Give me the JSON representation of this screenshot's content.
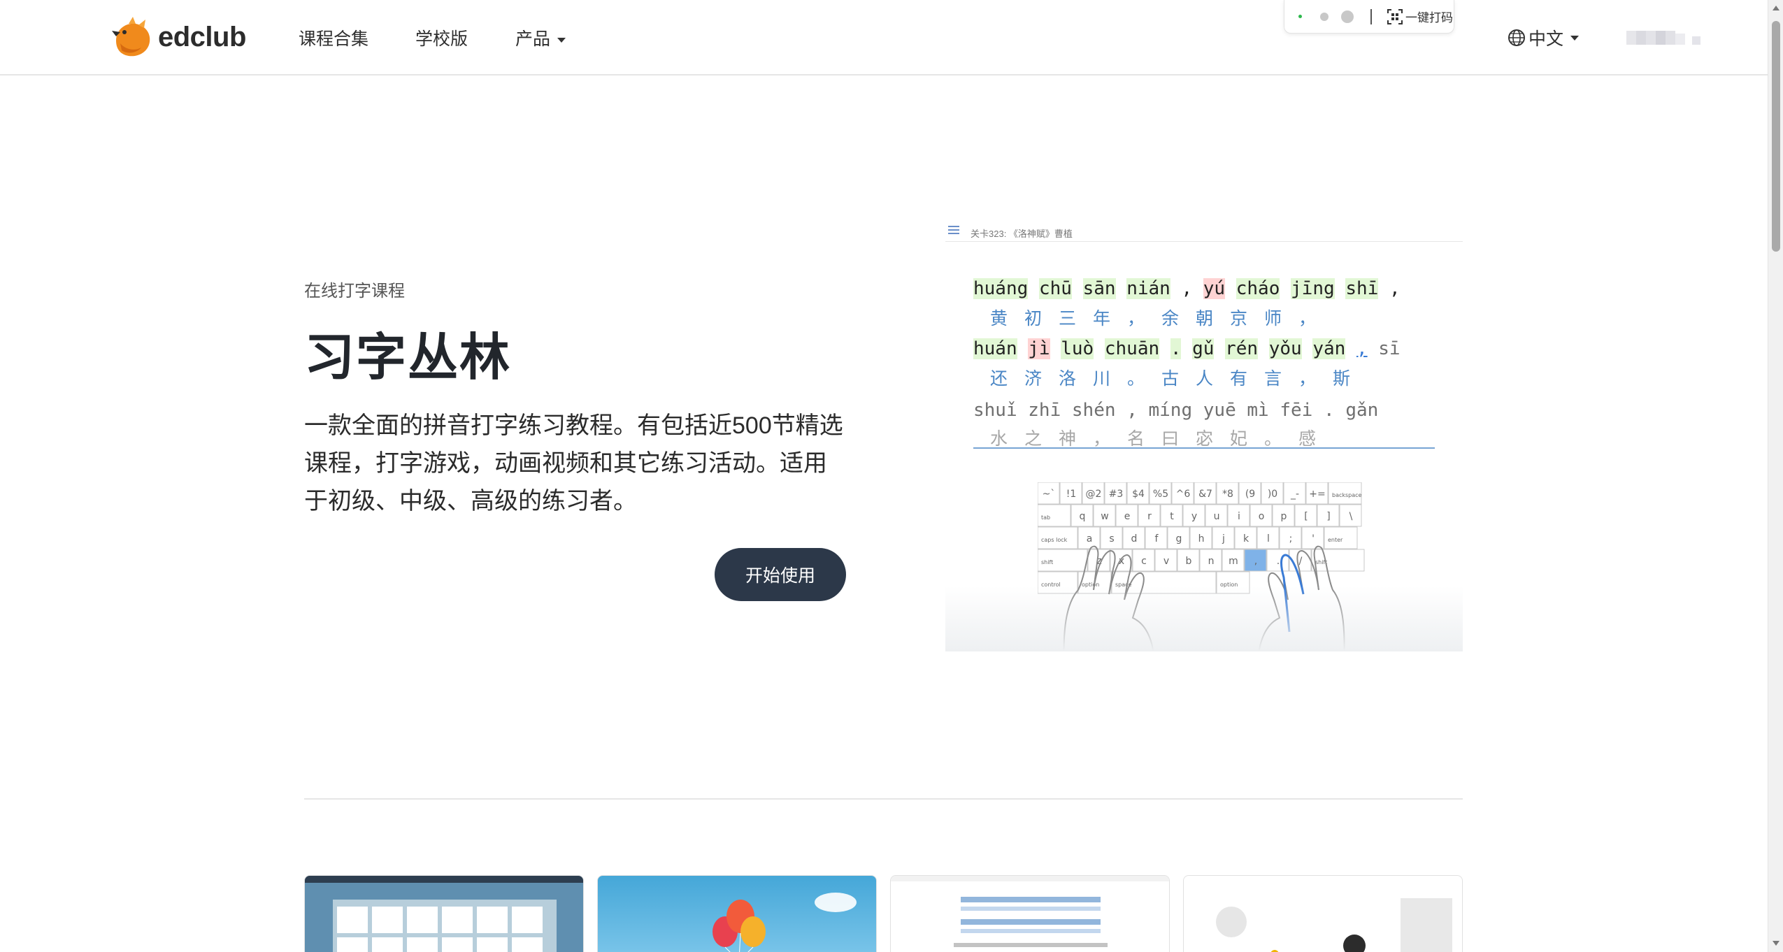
{
  "header": {
    "brand": "edclub",
    "nav": [
      {
        "label": "课程合集"
      },
      {
        "label": "学校版"
      },
      {
        "label": "产品"
      }
    ],
    "extension": {
      "scan_label": "一键打码"
    },
    "language": "中文"
  },
  "hero": {
    "eyebrow": "在线打字课程",
    "title": "习字丛林",
    "description": "一款全面的拼音打字练习教程。有包括近500节精选课程，打字游戏，动画视频和其它练习活动。适用于初级、中级、高级的练习者。",
    "cta": "开始使用"
  },
  "preview": {
    "lesson_title": "关卡323: 《洛神赋》曹植",
    "lines": [
      {
        "pinyin": [
          "huáng",
          "chū",
          "sān",
          "nián",
          ",",
          "yú",
          "cháo",
          "jīng",
          "shī",
          ","
        ],
        "hanzi": "黄初三年，余朝京师，"
      },
      {
        "pinyin": [
          "huán",
          "jì",
          "luò",
          "chuān",
          ".",
          "gǔ",
          "rén",
          "yǒu",
          "yán",
          ",",
          "sī"
        ],
        "hanzi": "还济洛川。古人有言，斯"
      },
      {
        "pinyin": [
          "shuǐ",
          "zhī",
          "shén",
          ",",
          "míng",
          "yuē",
          "mì",
          "fēi",
          ".",
          "gǎn"
        ],
        "hanzi": "水之神，名曰宓妃。感"
      }
    ],
    "keyboard": {
      "row1": [
        "~`",
        "!1",
        "@2",
        "#3",
        "$4",
        "%5",
        "^6",
        "&7",
        "*8",
        "(9",
        ")0",
        "_-",
        "+=",
        "backspace"
      ],
      "row2": [
        "tab",
        "q",
        "w",
        "e",
        "r",
        "t",
        "y",
        "u",
        "i",
        "o",
        "p",
        "[",
        "]",
        "\\"
      ],
      "row3": [
        "caps lock",
        "a",
        "s",
        "d",
        "f",
        "g",
        "h",
        "j",
        "k",
        "l",
        ";",
        "'",
        "enter"
      ],
      "row4": [
        "shift",
        "z",
        "x",
        "c",
        "v",
        "b",
        "n",
        "m",
        ",",
        ".",
        "/",
        "shift"
      ],
      "row5": [
        "control",
        "option",
        "space",
        "option"
      ]
    }
  },
  "colors": {
    "button": "#2c3849",
    "hanzi": "#4a86c5",
    "correct": "#e2f7d5",
    "error": "#ffd3d3",
    "brand_orange": "#f08a1c"
  }
}
